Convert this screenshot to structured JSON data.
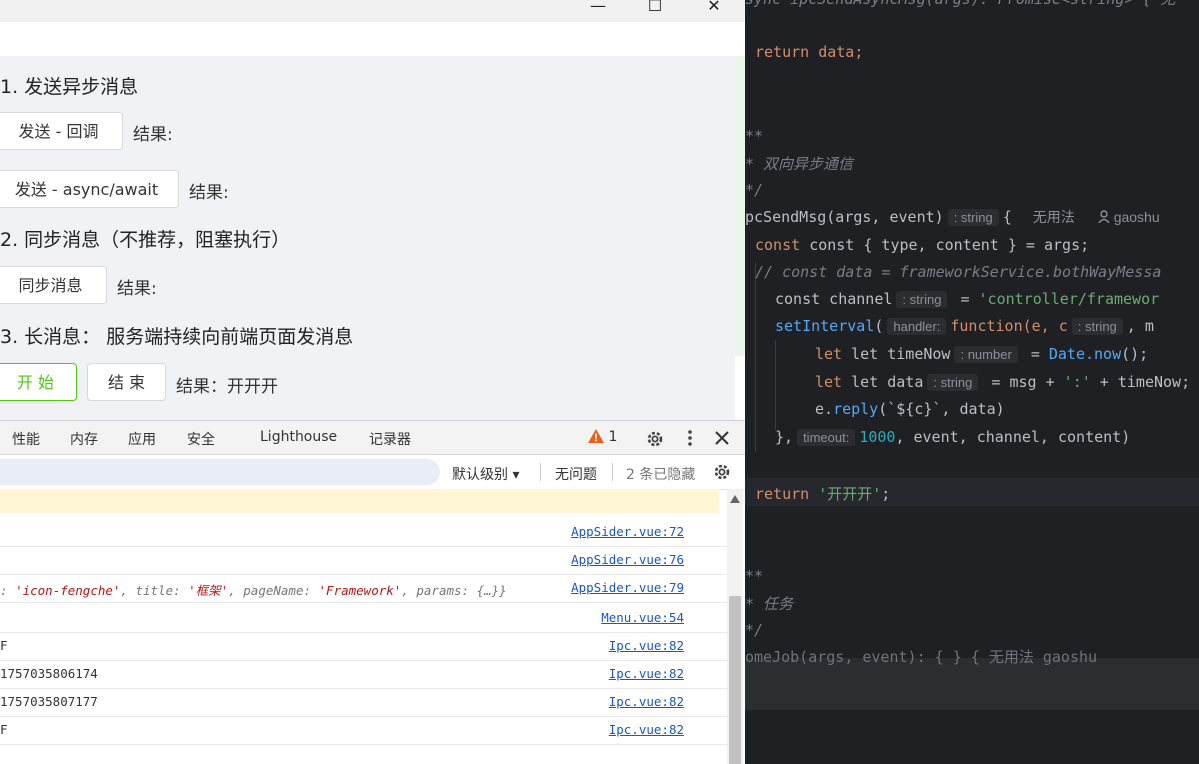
{
  "window": {
    "minimize": "—",
    "maximize": "☐",
    "close": "✕"
  },
  "app": {
    "s1": {
      "title": "1. 发送异步消息",
      "btn_callback": "发送 - 回调",
      "btn_async": "发送 - async/await",
      "result_label": "结果:"
    },
    "s2": {
      "title": "2. 同步消息（不推荐，阻塞执行）",
      "btn_sync": "同步消息",
      "result_label": "结果:"
    },
    "s3": {
      "title": "3. 长消息：  服务端持续向前端页面发消息",
      "btn_start": "开 始",
      "btn_end": "结 束",
      "result": "结果：开开开"
    }
  },
  "devtools": {
    "tabs": [
      "性能",
      "内存",
      "应用",
      "安全",
      "Lighthouse",
      "记录器"
    ],
    "warnings": "1",
    "filter": {
      "level": "默认级别 ▾",
      "issues": "无问题",
      "hidden": "2 条已隐藏"
    },
    "rows": [
      {
        "text": "",
        "source": "AppSider.vue:72"
      },
      {
        "text": "",
        "source": "AppSider.vue:76"
      },
      {
        "k1": ": ",
        "v1": "'icon-fengche'",
        "k2": ", title: ",
        "v2": "'框架'",
        "k3": ", pageName: ",
        "v3": "'Framework'",
        "k4": ", params: {…}}",
        "source": "AppSider.vue:79"
      },
      {
        "text": "",
        "source": "Menu.vue:54"
      },
      {
        "text": "F",
        "source": "Ipc.vue:82"
      },
      {
        "text": "1757035806174",
        "source": "Ipc.vue:82"
      },
      {
        "text": "1757035807177",
        "source": "Ipc.vue:82"
      },
      {
        "text": "F",
        "source": "Ipc.vue:82"
      }
    ]
  },
  "editor": {
    "l0": "sync ipcSendAsyncMsg(args): Promise<string> {  无",
    "l1": "return data;",
    "l2": "**",
    "l3": "* 双向异步通信",
    "l4": "*/",
    "l5_fn": "pcSendMsg(args, event)",
    "l5_hint": ": string",
    "l5_brace": "{",
    "l5_usage": "无用法",
    "l5_author": "gaoshu",
    "l6": "const { type, content } = args;",
    "l7": "// const data = frameworkService.bothWayMessa",
    "l8_a": "const channel",
    "l8_hint": ": string",
    "l8_b": "= ",
    "l8_str": "'controller/framewor",
    "l9_fn": "setInterval",
    "l9_hint": "handler:",
    "l9_b": "function(e, c",
    "l9_hint2": ": string",
    "l9_c": ", m",
    "l10_a": "let timeNow",
    "l10_hint": ": number",
    "l10_b": "= ",
    "l10_c": "Date.now",
    "l10_d": "();",
    "l11_a": "let data",
    "l11_hint": ": string",
    "l11_b": "= msg + ",
    "l11_str": "':'",
    "l11_c": " + timeNow;",
    "l12_a": "e.",
    "l12_fn": "reply",
    "l12_b": "(`${c}`, data)",
    "l13_a": "},",
    "l13_hint": "timeout:",
    "l13_num": "1000",
    "l13_b": ", event, channel, content)",
    "l14_kw": "return ",
    "l14_str": "'开开开'",
    "l14_b": ";",
    "l15": "**",
    "l16": "* 任务",
    "l17": "*/",
    "l18": "omeJob(args, event): {  } {  无用法  gaoshu"
  },
  "colors": {
    "accent_green": "#52c41a",
    "link_blue": "#1a56c4",
    "editor_bg": "#1f2023"
  }
}
